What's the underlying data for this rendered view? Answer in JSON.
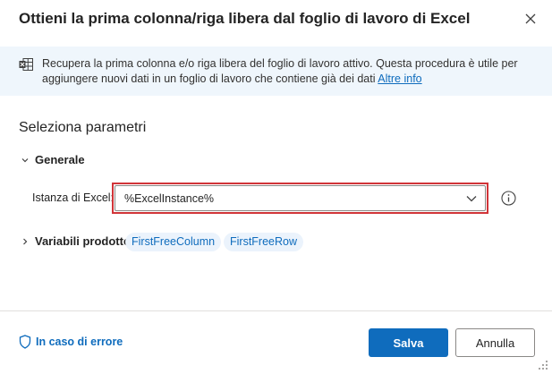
{
  "dialog": {
    "title": "Ottieni la prima colonna/riga libera dal foglio di lavoro di Excel",
    "close_icon": "close-icon"
  },
  "info": {
    "icon": "excel-icon",
    "text": "Recupera la prima colonna e/o riga libera del foglio di lavoro attivo. Questa procedura è utile per aggiungere nuovi dati in un foglio di lavoro che contiene già dei dati",
    "link": "Altre info"
  },
  "params": {
    "title": "Seleziona parametri",
    "general": {
      "label": "Generale",
      "excel_instance_label": "Istanza di Excel:",
      "excel_instance_value": "%ExcelInstance%"
    },
    "produced_variables": {
      "label": "Variabili prodotte",
      "chips": [
        "FirstFreeColumn",
        "FirstFreeRow"
      ]
    }
  },
  "footer": {
    "on_error": "In caso di errore",
    "save": "Salva",
    "cancel": "Annulla"
  },
  "colors": {
    "accent": "#0f6cbd",
    "highlight_outline": "#d13438",
    "banner_bg": "#eff6fc",
    "chip_bg": "#ebf3fc"
  }
}
